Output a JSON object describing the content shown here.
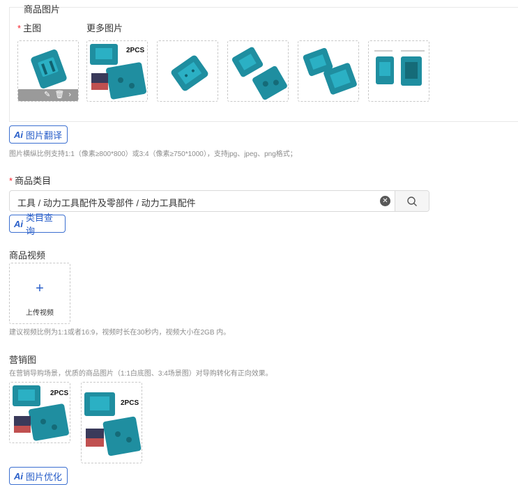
{
  "product_images": {
    "section_label": "商品图片",
    "main_label": "主图",
    "more_label": "更多图片",
    "thumb_badge": "2PCS"
  },
  "ai_translate": {
    "ai": "Ai",
    "label": "图片翻译"
  },
  "image_hint": "图片横纵比例支持1:1（像素≥800*800）或3:4（像素≥750*1000），支持jpg、jpeg、png格式；",
  "category": {
    "label": "商品类目",
    "value": "工具 / 动力工具配件及零部件 / 动力工具配件"
  },
  "ai_category": {
    "ai": "Ai",
    "label": "类目查询"
  },
  "video": {
    "label": "商品视频",
    "upload_label": "上传视频",
    "hint": "建议视频比例为1:1或者16:9，视频时长在30秒内，视频大小在2GB 内。"
  },
  "marketing": {
    "label": "营销图",
    "hint": "在营销导购场景，优质的商品图片（1:1白底图、3:4场景图）对导购转化有正向效果。",
    "badge": "2PCS"
  },
  "ai_optimize": {
    "ai": "Ai",
    "label": "图片优化"
  },
  "colors": {
    "accent": "#2a5fc9",
    "required": "#f5222d",
    "product_teal": "#1f8ea0"
  }
}
